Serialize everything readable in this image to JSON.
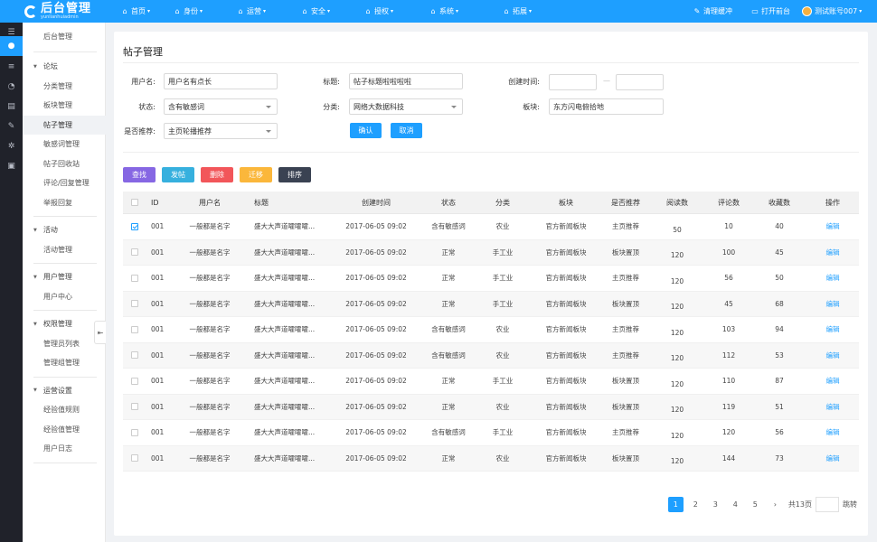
{
  "brand": {
    "title": "后台管理",
    "subtitle": "yunlianhuiadmin"
  },
  "topnav": [
    {
      "icon": "home-icon",
      "glyph": "⌂",
      "label": "首页"
    },
    {
      "icon": "identity-icon",
      "glyph": "⌂",
      "label": "身份"
    },
    {
      "icon": "operations-icon",
      "glyph": "⌂",
      "label": "运营"
    },
    {
      "icon": "security-icon",
      "glyph": "⌂",
      "label": "安全"
    },
    {
      "icon": "authorize-icon",
      "glyph": "⌂",
      "label": "授权"
    },
    {
      "icon": "system-icon",
      "glyph": "⌂",
      "label": "系统"
    },
    {
      "icon": "extend-icon",
      "glyph": "⌂",
      "label": "拓展"
    }
  ],
  "topright": {
    "clear_cache": "清理缓冲",
    "open_front": "打开前台",
    "account": "测试账号007"
  },
  "sidebar": {
    "home": "后台管理",
    "groups": [
      {
        "label": "论坛",
        "items": [
          "分类管理",
          "板块管理",
          "帖子管理",
          "敏感词管理",
          "帖子回收站",
          "评论/回复管理",
          "举报回复"
        ]
      },
      {
        "label": "活动",
        "items": [
          "活动管理"
        ]
      },
      {
        "label": "用户管理",
        "items": [
          "用户中心"
        ]
      },
      {
        "label": "权限管理",
        "items": [
          "管理员列表",
          "管理组管理"
        ]
      },
      {
        "label": "运营设置",
        "items": [
          "经验值规则",
          "经验值管理",
          "用户日志"
        ]
      }
    ],
    "selected": "帖子管理"
  },
  "page": {
    "title": "帖子管理"
  },
  "filters": {
    "username_label": "用户名:",
    "username_value": "用户名有点长",
    "title_label": "标题:",
    "title_value": "帖子标题啦啦啦啦",
    "created_label": "创建时间:",
    "range_sep": "—",
    "status_label": "状态:",
    "status_value": "含有敏感词",
    "category_label": "分类:",
    "category_value": "网络大数据科技",
    "board_label": "板块:",
    "board_value": "东方闪电俯拾地",
    "recommend_label": "是否推荐:",
    "recommend_value": "主页轮播推荐",
    "confirm": "确认",
    "cancel": "取消"
  },
  "actions": {
    "search": "查找",
    "post": "发帖",
    "delete": "删除",
    "move": "迁移",
    "sort": "排序"
  },
  "table": {
    "headers": [
      "ID",
      "用户名",
      "标题",
      "创建时间",
      "状态",
      "分类",
      "板块",
      "是否推荐",
      "阅读数",
      "评论数",
      "收藏数",
      "操作"
    ],
    "rows": [
      {
        "checked": true,
        "id": "001",
        "user": "一般都是名字",
        "title": "盛大大声道嚯嚯嚯...",
        "time": "2017-06-05  09:02",
        "status": "含有敏感词",
        "cat": "农业",
        "board": "官方新闻板块",
        "rec": "主页推荐",
        "read": "50",
        "comment": "10",
        "fav": "40",
        "op": "编辑"
      },
      {
        "checked": false,
        "id": "001",
        "user": "一般都是名字",
        "title": "盛大大声道嚯嚯嚯...",
        "time": "2017-06-05  09:02",
        "status": "正常",
        "cat": "手工业",
        "board": "官方新闻板块",
        "rec": "板块置顶",
        "read": "120",
        "comment": "100",
        "fav": "45",
        "op": "编辑"
      },
      {
        "checked": false,
        "id": "001",
        "user": "一般都是名字",
        "title": "盛大大声道嚯嚯嚯...",
        "time": "2017-06-05  09:02",
        "status": "正常",
        "cat": "手工业",
        "board": "官方新闻板块",
        "rec": "主页推荐",
        "read": "120",
        "comment": "56",
        "fav": "50",
        "op": "编辑"
      },
      {
        "checked": false,
        "id": "001",
        "user": "一般都是名字",
        "title": "盛大大声道嚯嚯嚯...",
        "time": "2017-06-05  09:02",
        "status": "正常",
        "cat": "手工业",
        "board": "官方新闻板块",
        "rec": "板块置顶",
        "read": "120",
        "comment": "45",
        "fav": "68",
        "op": "编辑"
      },
      {
        "checked": false,
        "id": "001",
        "user": "一般都是名字",
        "title": "盛大大声道嚯嚯嚯...",
        "time": "2017-06-05  09:02",
        "status": "含有敏感词",
        "cat": "农业",
        "board": "官方新闻板块",
        "rec": "主页推荐",
        "read": "120",
        "comment": "103",
        "fav": "94",
        "op": "编辑"
      },
      {
        "checked": false,
        "id": "001",
        "user": "一般都是名字",
        "title": "盛大大声道嚯嚯嚯...",
        "time": "2017-06-05  09:02",
        "status": "含有敏感词",
        "cat": "农业",
        "board": "官方新闻板块",
        "rec": "主页推荐",
        "read": "120",
        "comment": "112",
        "fav": "53",
        "op": "编辑"
      },
      {
        "checked": false,
        "id": "001",
        "user": "一般都是名字",
        "title": "盛大大声道嚯嚯嚯...",
        "time": "2017-06-05  09:02",
        "status": "正常",
        "cat": "手工业",
        "board": "官方新闻板块",
        "rec": "板块置顶",
        "read": "120",
        "comment": "110",
        "fav": "87",
        "op": "编辑"
      },
      {
        "checked": false,
        "id": "001",
        "user": "一般都是名字",
        "title": "盛大大声道嚯嚯嚯...",
        "time": "2017-06-05  09:02",
        "status": "正常",
        "cat": "农业",
        "board": "官方新闻板块",
        "rec": "板块置顶",
        "read": "120",
        "comment": "119",
        "fav": "51",
        "op": "编辑"
      },
      {
        "checked": false,
        "id": "001",
        "user": "一般都是名字",
        "title": "盛大大声道嚯嚯嚯...",
        "time": "2017-06-05  09:02",
        "status": "含有敏感词",
        "cat": "手工业",
        "board": "官方新闻板块",
        "rec": "主页推荐",
        "read": "120",
        "comment": "120",
        "fav": "56",
        "op": "编辑"
      },
      {
        "checked": false,
        "id": "001",
        "user": "一般都是名字",
        "title": "盛大大声道嚯嚯嚯...",
        "time": "2017-06-05  09:02",
        "status": "正常",
        "cat": "农业",
        "board": "官方新闻板块",
        "rec": "板块置顶",
        "read": "120",
        "comment": "144",
        "fav": "73",
        "op": "编辑"
      }
    ]
  },
  "pager": {
    "pages": [
      "1",
      "2",
      "3",
      "4",
      "5"
    ],
    "current": "1",
    "next": "›",
    "total": "共13页",
    "jump": "跳转"
  },
  "colors": {
    "primary": "#1e9fff",
    "rail": "#20222a",
    "purple": "#8667e3",
    "cyan": "#36b0de",
    "red": "#f2565a",
    "orange": "#fbb73b",
    "dark": "#3a4252"
  }
}
